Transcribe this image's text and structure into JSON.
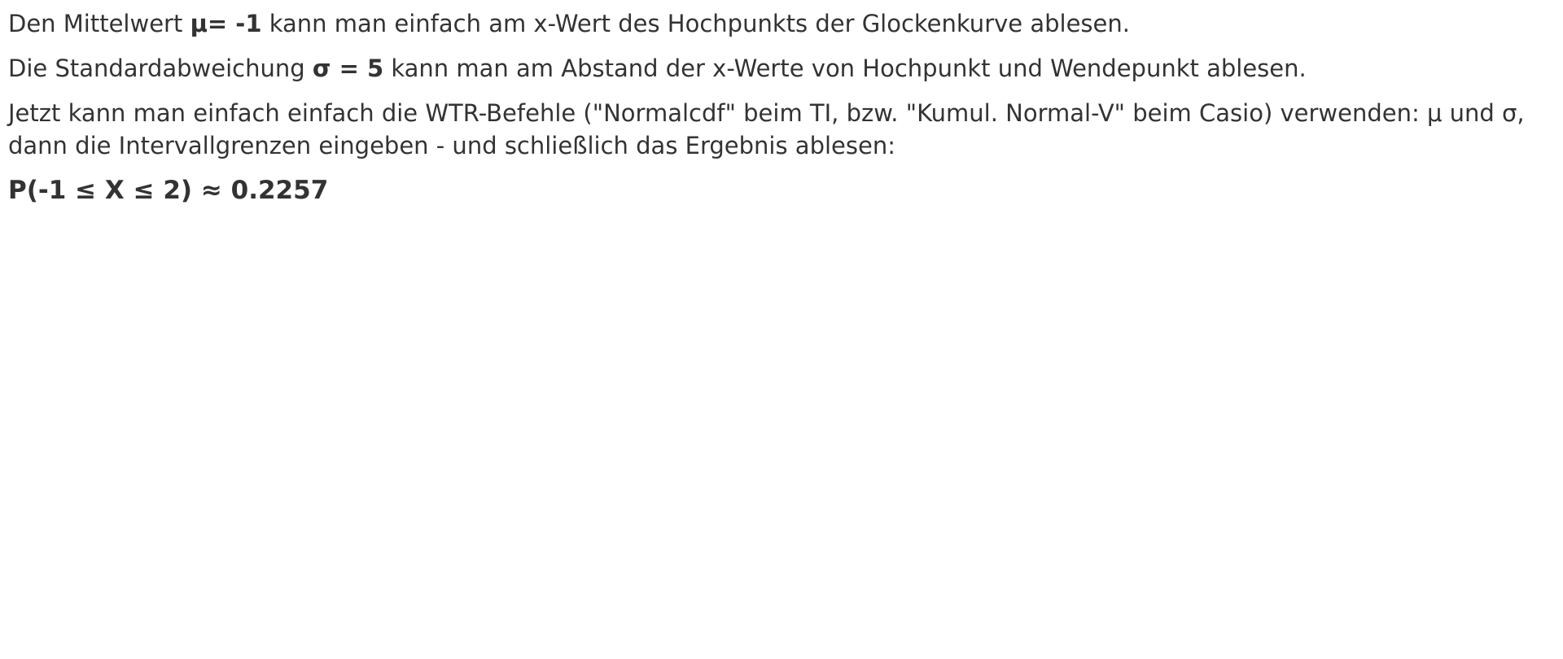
{
  "paragraph1": {
    "pre": "Den Mittelwert ",
    "bold": "μ= -1",
    "post": " kann man einfach am x-Wert des Hochpunkts der Glockenkurve ablesen."
  },
  "paragraph2": {
    "pre": "Die Standardabweichung ",
    "bold": "σ = 5",
    "post": " kann man am Abstand der x-Werte von Hochpunkt und Wendepunkt ablesen."
  },
  "paragraph3": {
    "text": "Jetzt kann man einfach einfach die WTR-Befehle (\"Normalcdf\" beim TI, bzw. \"Kumul. Normal-V\" beim Casio) verwenden: μ und σ, dann die Intervallgrenzen eingeben - und schließlich das Ergebnis ablesen:"
  },
  "result": {
    "text": "P(-1 ≤ X ≤ 2) ≈ 0.2257"
  }
}
